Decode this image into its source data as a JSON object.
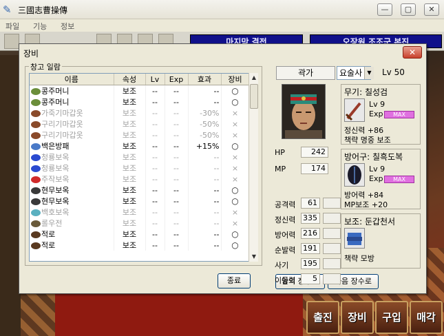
{
  "window": {
    "title": "三國志曹操傳",
    "minimize_label": "—",
    "maximize_label": "▢",
    "close_label": "✕"
  },
  "menu": [
    "파일",
    "기능",
    "정보"
  ],
  "banners": [
    "마지막 결전",
    "오장원 조조군 본진"
  ],
  "commands": [
    "출진",
    "장비",
    "구입",
    "매각"
  ],
  "dialog": {
    "title": "장비",
    "close_label": "✕",
    "group_label": "창고 일람",
    "columns": [
      "이름",
      "속성",
      "Lv",
      "Exp",
      "효과",
      "장비"
    ],
    "rows": [
      {
        "name": "콩주머니",
        "attr": "보조",
        "lv": "--",
        "exp": "--",
        "effect": "--",
        "equip": "○",
        "dim": false,
        "icon": "#6b8e3a"
      },
      {
        "name": "콩주머니",
        "attr": "보조",
        "lv": "--",
        "exp": "--",
        "effect": "--",
        "equip": "○",
        "dim": false,
        "icon": "#6b8e3a"
      },
      {
        "name": "가죽기마갑옷",
        "attr": "보조",
        "lv": "--",
        "exp": "--",
        "effect": "-30%",
        "equip": "×",
        "dim": true,
        "icon": "#8a4a2a"
      },
      {
        "name": "구리기마갑옷",
        "attr": "보조",
        "lv": "--",
        "exp": "--",
        "effect": "-50%",
        "equip": "×",
        "dim": true,
        "icon": "#8a4a2a"
      },
      {
        "name": "구리기마갑옷",
        "attr": "보조",
        "lv": "--",
        "exp": "--",
        "effect": "-50%",
        "equip": "×",
        "dim": true,
        "icon": "#8a4a2a"
      },
      {
        "name": "백은방패",
        "attr": "보조",
        "lv": "--",
        "exp": "--",
        "effect": "+15%",
        "equip": "○",
        "dim": false,
        "icon": "#4a7ac8"
      },
      {
        "name": "청룡보옥",
        "attr": "보조",
        "lv": "--",
        "exp": "--",
        "effect": "--",
        "equip": "×",
        "dim": true,
        "icon": "#2a4ad0"
      },
      {
        "name": "청룡보옥",
        "attr": "보조",
        "lv": "--",
        "exp": "--",
        "effect": "--",
        "equip": "×",
        "dim": true,
        "icon": "#2a4ad0"
      },
      {
        "name": "주작보옥",
        "attr": "보조",
        "lv": "--",
        "exp": "--",
        "effect": "--",
        "equip": "×",
        "dim": true,
        "icon": "#d02a2a"
      },
      {
        "name": "현무보옥",
        "attr": "보조",
        "lv": "--",
        "exp": "--",
        "effect": "--",
        "equip": "○",
        "dim": false,
        "icon": "#3a3a3a"
      },
      {
        "name": "현무보옥",
        "attr": "보조",
        "lv": "--",
        "exp": "--",
        "effect": "--",
        "equip": "○",
        "dim": false,
        "icon": "#3a3a3a"
      },
      {
        "name": "백호보옥",
        "attr": "보조",
        "lv": "--",
        "exp": "--",
        "effect": "--",
        "equip": "×",
        "dim": true,
        "icon": "#5ab0c0"
      },
      {
        "name": "롤우전",
        "attr": "보조",
        "lv": "--",
        "exp": "--",
        "effect": "--",
        "equip": "×",
        "dim": true,
        "icon": "#6a5a3a"
      },
      {
        "name": "적로",
        "attr": "보조",
        "lv": "--",
        "exp": "--",
        "effect": "--",
        "equip": "○",
        "dim": false,
        "icon": "#5a3a20"
      },
      {
        "name": "적로",
        "attr": "보조",
        "lv": "--",
        "exp": "--",
        "effect": "--",
        "equip": "○",
        "dim": false,
        "icon": "#5a3a20"
      }
    ],
    "ok_label": "종료",
    "prev_label": "앞의 장수로",
    "next_label": "다음 장수로"
  },
  "hero": {
    "name": "곽가",
    "class": "요술사",
    "lv_label": "Lv",
    "lv": "50",
    "stats": [
      {
        "label": "HP",
        "value": "242"
      },
      {
        "label": "MP",
        "value": "174"
      }
    ],
    "abilities": [
      {
        "label": "공격력",
        "value": "61"
      },
      {
        "label": "정신력",
        "value": "335"
      },
      {
        "label": "방어력",
        "value": "216"
      },
      {
        "label": "순발력",
        "value": "191"
      },
      {
        "label": "사기",
        "value": "195"
      },
      {
        "label": "이동력",
        "value": "5"
      }
    ],
    "weapon": {
      "title": "무기: 칠성검",
      "lv": "Lv  9",
      "exp_label": "Exp",
      "exp_bar": "MAX",
      "line1": "정신력 +86",
      "line2": "책략 명중 보조"
    },
    "armor": {
      "title": "방어구: 칠흑도복",
      "lv": "Lv  9",
      "exp_label": "Exp",
      "exp_bar": "MAX",
      "line1": "방어력 +84",
      "line2": "MP보조 +20"
    },
    "aux": {
      "title": "보조: 둔갑천서",
      "line1": "책략 모방"
    }
  }
}
